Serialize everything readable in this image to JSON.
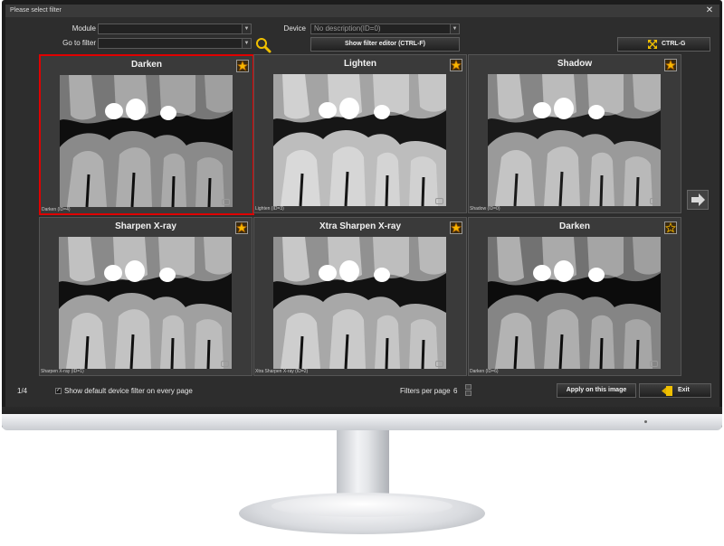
{
  "window": {
    "title": "Please select filter",
    "close_glyph": "✕"
  },
  "toolbar": {
    "module_label": "Module",
    "module_value": "",
    "goto_label": "Go to filter",
    "goto_value": "",
    "device_label": "Device",
    "device_value": "No description(ID=0)",
    "show_editor_label": "Show filter editor (CTRL-F)",
    "fullscreen_label": "CTRL-G"
  },
  "filters": [
    {
      "title": "Darken",
      "caption": "Darken (ID=4)",
      "favorite": true,
      "selected": true
    },
    {
      "title": "Lighten",
      "caption": "Lighten (ID=3)",
      "favorite": true,
      "selected": false
    },
    {
      "title": "Shadow",
      "caption": "Shadow (ID=0)",
      "favorite": true,
      "selected": false
    },
    {
      "title": "Sharpen X-ray",
      "caption": "Sharpen X-ray (ID=1)",
      "favorite": true,
      "selected": false
    },
    {
      "title": "Xtra Sharpen X-ray",
      "caption": "Xtra Sharpen X-ray (ID=2)",
      "favorite": true,
      "selected": false
    },
    {
      "title": "Darken",
      "caption": "Darken (ID=6)",
      "favorite": false,
      "selected": false
    }
  ],
  "footer": {
    "page_indicator": "1/4",
    "show_default_label": "Show default device filter on every page",
    "filters_per_page_label": "Filters per page",
    "filters_per_page_value": "6",
    "apply_label": "Apply on this image",
    "exit_label": "Exit"
  },
  "icons": {
    "favorite": "star-filled-icon",
    "not_favorite": "star-outline-icon",
    "search": "magnifier-icon",
    "fullscreen": "expand-arrows-icon",
    "next": "arrow-right-icon",
    "exit": "exit-door-icon"
  },
  "colors": {
    "selected_border": "#e00000",
    "star_fill": "#f6b800",
    "icon_yellow": "#f0c000"
  }
}
